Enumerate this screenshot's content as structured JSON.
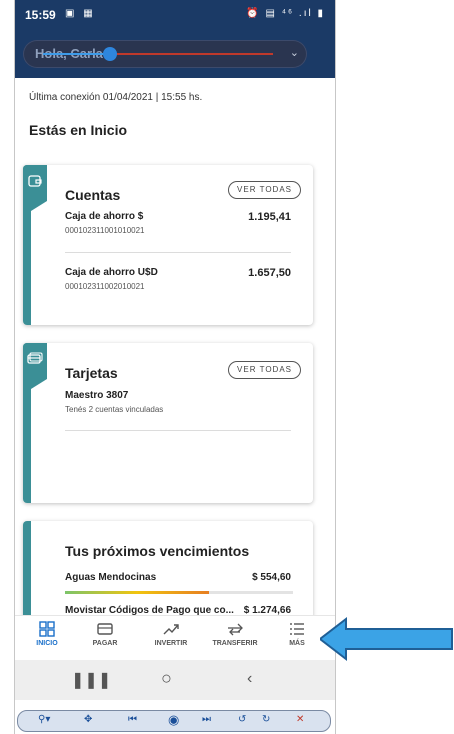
{
  "status_bar": {
    "time": "15:59",
    "left_icons": "▣ ▦",
    "right_icons": "⏰ ▤ ⁴⁶ .ıl ▮"
  },
  "header": {
    "greeting": "Hola, Carla"
  },
  "last_connection": "Última conexión 01/04/2021 | 15:55 hs.",
  "page_title": "Estás en Inicio",
  "cuentas": {
    "title": "Cuentas",
    "button": "VER TODAS",
    "items": [
      {
        "name": "Caja de ahorro $",
        "number": "000102311001010021",
        "amount": "1.195,41"
      },
      {
        "name": "Caja de ahorro U$D",
        "number": "000102311002010021",
        "amount": "1.657,50"
      }
    ]
  },
  "tarjetas": {
    "title": "Tarjetas",
    "button": "VER TODAS",
    "card_name": "Maestro 3807",
    "subtitle": "Tenés 2 cuentas vinculadas"
  },
  "vencimientos": {
    "title": "Tus próximos vencimientos",
    "items": [
      {
        "name": "Aguas Mendocinas",
        "amount": "$ 554,60"
      },
      {
        "name": "Movistar Códigos de Pago que co...",
        "amount": "$ 1.274,66"
      }
    ]
  },
  "bottom_nav": [
    {
      "label": "INICIO",
      "icon": "grid-icon",
      "active": true
    },
    {
      "label": "PAGAR",
      "icon": "credit-card-icon",
      "active": false
    },
    {
      "label": "INVERTIR",
      "icon": "trend-up-icon",
      "active": false
    },
    {
      "label": "TRANSFERIR",
      "icon": "transfer-icon",
      "active": false
    },
    {
      "label": "MÁS",
      "icon": "menu-icon",
      "active": false
    }
  ],
  "colors": {
    "header_bg": "#1b3a66",
    "accent": "#3b8f96",
    "nav_active": "#1a6fc9",
    "arrow": "#3ba3e6"
  }
}
